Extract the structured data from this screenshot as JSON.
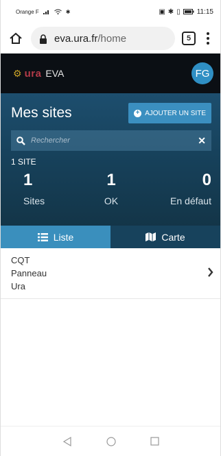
{
  "status_bar": {
    "carrier": "Orange F",
    "time": "11:15"
  },
  "browser": {
    "url_host": "eva.ura.fr",
    "url_path": "/home",
    "tab_count": "5"
  },
  "app": {
    "brand_logo": "ura",
    "brand_name": "EVA",
    "avatar_initials": "FG"
  },
  "sites": {
    "title": "Mes sites",
    "add_button": "AJOUTER UN SITE",
    "search_placeholder": "Rechercher",
    "count_label": "1 SITE",
    "stats": [
      {
        "value": "1",
        "label": "Sites"
      },
      {
        "value": "1",
        "label": "OK"
      },
      {
        "value": "0",
        "label": "En défaut"
      }
    ]
  },
  "view_tabs": [
    {
      "label": "Liste",
      "icon": "list-icon",
      "active": true
    },
    {
      "label": "Carte",
      "icon": "map-icon",
      "active": false
    }
  ],
  "site_list": [
    {
      "line1": "CQT",
      "line2": "Panneau",
      "line3": "Ura"
    }
  ],
  "colors": {
    "app_bar": "#0b0f14",
    "hero": "#17425c",
    "accent": "#3a8fbd",
    "avatar": "#2f8fc4",
    "brand_red": "#b23a48"
  }
}
